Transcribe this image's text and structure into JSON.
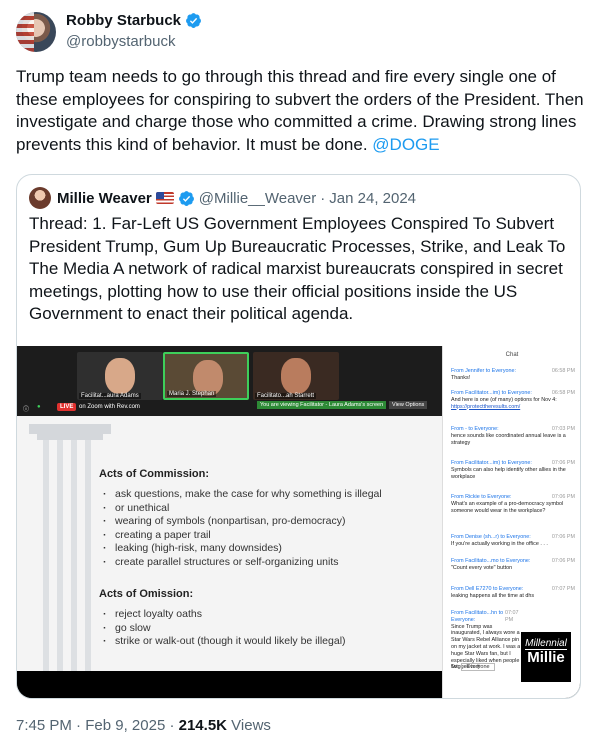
{
  "author": {
    "name": "Robby Starbuck",
    "handle": "@robbystarbuck"
  },
  "tweet": {
    "text": "Trump team needs to go through this thread and fire every single one of these employees for conspiring to subvert the orders of the President. Then investigate and charge those who committed a crime. Drawing strong lines prevents this kind of behavior. It must be done.",
    "mention": "@DOGE"
  },
  "quote": {
    "name": "Millie Weaver",
    "handle": "@Millie__Weaver",
    "separator": "·",
    "date": "Jan 24, 2024",
    "text": "Thread: 1. Far-Left US Government Employees Conspired To Subvert President Trump, Gum Up Bureaucratic Processes, Strike, and Leak To The Media A network of radical marxist bureaucrats conspired in secret meetings, plotting how to use their official positions inside the US Government to enact their political agenda."
  },
  "media": {
    "tiles": [
      {
        "label": "Facilitat...aura Adams"
      },
      {
        "label": "Maria J. Stephan"
      },
      {
        "label": "Facilitato...ah Starrett"
      }
    ],
    "live_label": "LIVE",
    "zoom_label": "on Zoom with Rev.com",
    "viewing_label": "You are viewing Facilitator - Laura Adams's screen",
    "view_options": "View Options",
    "slide": {
      "commission_title": "Acts of Commission:",
      "commission": [
        "ask questions, make the case for why something is illegal",
        "or unethical",
        "wearing of symbols (nonpartisan, pro-democracy)",
        "creating a paper trail",
        "leaking (high-risk, many downsides)",
        "create parallel structures or self-organizing units"
      ],
      "omission_title": "Acts of Omission:",
      "omission": [
        "reject loyalty oaths",
        "go slow",
        "strike or walk-out (though it would likely be illegal)"
      ]
    },
    "chat": {
      "title": "Chat",
      "messages": [
        {
          "from": "From Jennifer to Everyone:",
          "time": "06:58 PM",
          "text": "Thanks!"
        },
        {
          "from": "From Facilitator...im) to Everyone:",
          "time": "06:58 PM",
          "text": "And here is one (of many) options for Nov 4:",
          "link": "https://protecttheresults.com/"
        },
        {
          "from": "From - to Everyone:",
          "time": "07:03 PM",
          "text": "hence sounds like coordinated annual leave is a strategy"
        },
        {
          "from": "From Facilitator...im) to Everyone:",
          "time": "07:06 PM",
          "text": "Symbols can also help identify other allies in the workplace"
        },
        {
          "from": "From Rickie to Everyone:",
          "time": "07:06 PM",
          "text": "What's an example of a pro-democracy symbol someone would wear in the workplace?"
        },
        {
          "from": "From Denise (sh...r) to Everyone:",
          "time": "07:06 PM",
          "text": "If you're actually working in the office . . ."
        },
        {
          "from": "From Facilitato...mo to Everyone:",
          "time": "07:06 PM",
          "text": "\"Count every vote\" button"
        },
        {
          "from": "From Dell E7270 to Everyone:",
          "time": "07:07 PM",
          "text": "leaking happens all the time at dhs"
        },
        {
          "from": "From Facilitato...hn to Everyone:",
          "time": "07:07 PM",
          "text": "Since Trump was inaugurated, I always wore a Star Wars Rebel Alliance pin on my jacket at work. I was a huge Star Wars fan, but I especially liked when people twigged to it"
        }
      ],
      "to_label": "To:",
      "to_value": "Everyone"
    },
    "logo": {
      "line1": "Millennial",
      "line2": "Millie"
    }
  },
  "meta": {
    "time": "7:45 PM",
    "dot": "·",
    "date": "Feb 9, 2025",
    "views_count": "214.5K",
    "views_label": "Views"
  },
  "colors": {
    "accent": "#1d9bf0",
    "verified": "#1d9bf0",
    "text": "#0f1419",
    "secondary": "#536471",
    "border": "#cfd9de"
  }
}
